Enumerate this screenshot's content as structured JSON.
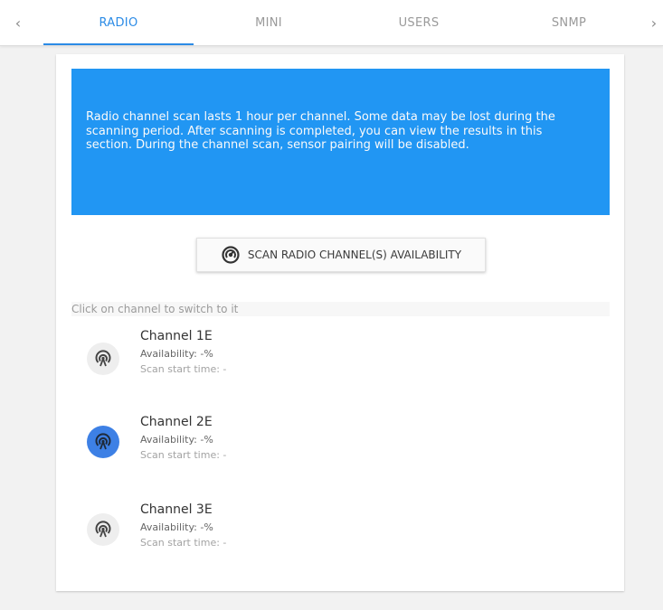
{
  "tabs": {
    "prev_arrow": "‹",
    "next_arrow": "›",
    "items": [
      {
        "label": "RADIO",
        "active": true
      },
      {
        "label": "MINI",
        "active": false
      },
      {
        "label": "USERS",
        "active": false
      },
      {
        "label": "SNMP",
        "active": false
      }
    ]
  },
  "info": {
    "message": "Radio channel scan lasts 1 hour per channel. Some data may be lost during the scanning period. After scanning is completed, you can view the results in this section. During the channel scan, sensor pairing will be disabled.",
    "background_color": "#2196f3"
  },
  "scan_button": {
    "label": "SCAN RADIO CHANNEL(S) AVAILABILITY",
    "icon": "scan-icon"
  },
  "hint": "Click on channel to switch to it",
  "channels": [
    {
      "name": "Channel 1E",
      "availability": "Availability: -%",
      "scan_start": "Scan start time: -",
      "selected": false,
      "icon": "radio-signal-icon"
    },
    {
      "name": "Channel 2E",
      "availability": "Availability: -%",
      "scan_start": "Scan start time: -",
      "selected": true,
      "icon": "radio-signal-icon"
    },
    {
      "name": "Channel 3E",
      "availability": "Availability: -%",
      "scan_start": "Scan start time: -",
      "selected": false,
      "icon": "radio-signal-icon"
    }
  ],
  "colors": {
    "accent": "#2b8be6",
    "selected_channel": "#3d80e5"
  }
}
